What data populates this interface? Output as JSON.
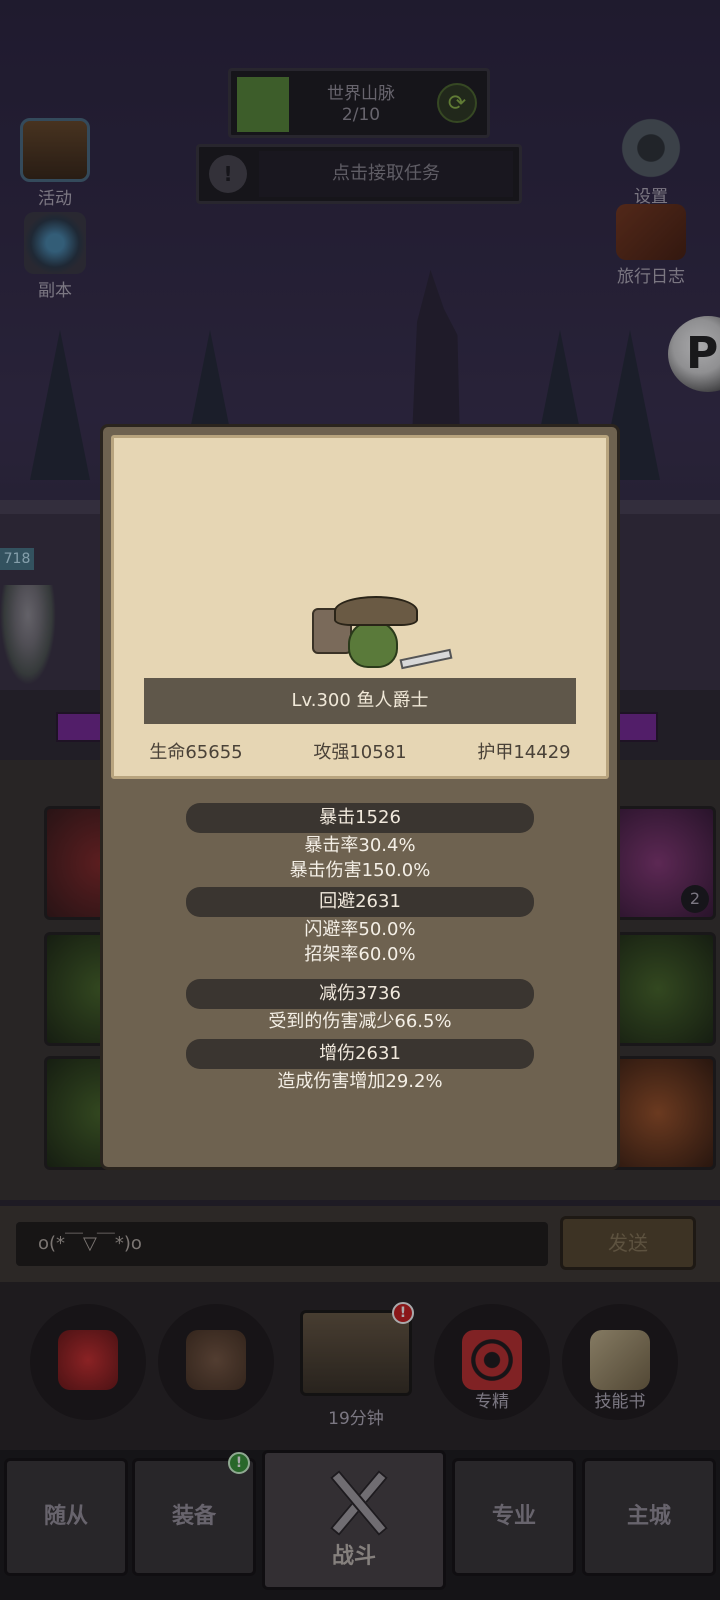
{
  "stage": {
    "title": "世界山脉",
    "progress_text": "2/10",
    "progress_fraction": 0.2
  },
  "quest": {
    "icon_text": "!",
    "text": "点击接取任务"
  },
  "side": {
    "activity": "活动",
    "dungeon": "副本",
    "settings": "设置",
    "journal": "旅行日志"
  },
  "badge_p": "P",
  "hero_hp": "718",
  "monster": {
    "title": "Lv.300 鱼人爵士",
    "stats": {
      "hp": "生命65655",
      "attack": "攻强10581",
      "armor": "护甲14429"
    },
    "attributes": [
      {
        "name": "暴击1526",
        "details": [
          "暴击率30.4%",
          "暴击伤害150.0%"
        ]
      },
      {
        "name": "回避2631",
        "details": [
          "闪避率50.0%",
          "招架率60.0%"
        ]
      },
      {
        "name": "减伤3736",
        "details": [
          "受到的伤害减少66.5%"
        ]
      },
      {
        "name": "增伤2631",
        "details": [
          "造成伤害增加29.2%"
        ]
      }
    ]
  },
  "grid": {
    "count_badge": "2"
  },
  "chat": {
    "input_value": "o(*￣▽￣*)o",
    "send": "发送"
  },
  "actions": {
    "chest_timer": "19分钟",
    "chest_alert": "!",
    "mastery": "专精",
    "skill_book": "技能书"
  },
  "nav": {
    "followers": "随从",
    "equipment": "装备",
    "equipment_alert": "!",
    "battle": "战斗",
    "profession": "专业",
    "main_city": "主城"
  },
  "colors": {
    "parchment": "#e6d6b4",
    "panel": "#6e6250",
    "stage_fill": "#5a8a3a",
    "accent_purple": "#7a2a9a"
  }
}
